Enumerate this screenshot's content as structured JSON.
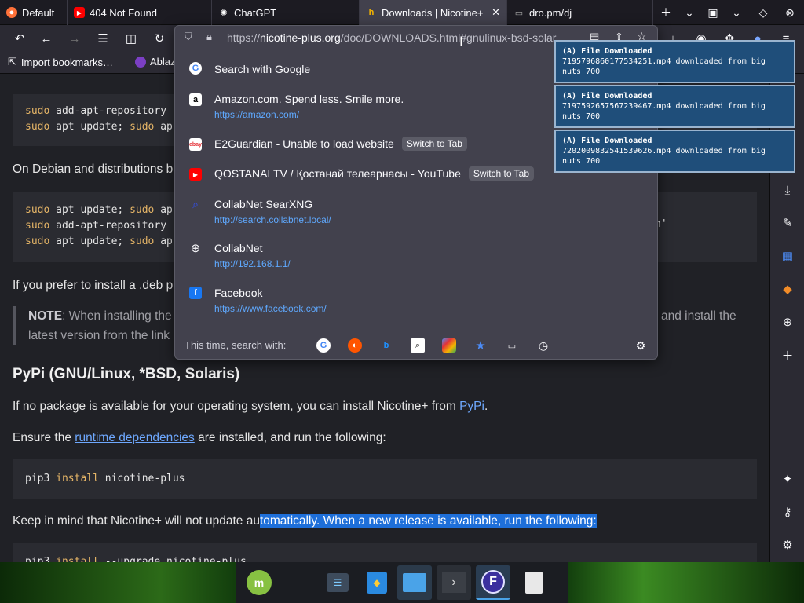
{
  "tabs": [
    {
      "title": "Default",
      "icon": "firefox-icon"
    },
    {
      "title": "404 Not Found",
      "icon": "youtube-icon"
    },
    {
      "title": "ChatGPT",
      "icon": "openai-icon"
    },
    {
      "title": "Downloads | Nicotine+",
      "icon": "nicotine-icon",
      "active": true
    },
    {
      "title": "dro.pm/dj",
      "icon": "page-icon"
    }
  ],
  "urlbar": {
    "prefix": "https://",
    "host": "nicotine-plus.org",
    "path": "/doc/DOWNLOADS.html#gnulinux-bsd-solar"
  },
  "bookmarks": {
    "import_label": "Import bookmarks…",
    "item2": "Ablaz"
  },
  "suggestions": [
    {
      "title": "Search with Google",
      "url": "",
      "icon": "google-icon"
    },
    {
      "title": "Amazon.com. Spend less. Smile more.",
      "url": "https://amazon.com/",
      "icon": "amazon-icon"
    },
    {
      "title": "E2Guardian - Unable to load website",
      "url": "",
      "icon": "ebay-icon",
      "action": "Switch to Tab"
    },
    {
      "title": "QOSTANAI TV / Қостанай телеарнасы - YouTube",
      "url": "",
      "icon": "youtube-icon",
      "action": "Switch to Tab"
    },
    {
      "title": "CollabNet SearXNG",
      "url": "http://search.collabnet.local/",
      "icon": "search-icon"
    },
    {
      "title": "CollabNet",
      "url": "http://192.168.1.1/",
      "icon": "globe-icon"
    },
    {
      "title": "Facebook",
      "url": "https://www.facebook.com/",
      "icon": "facebook-icon"
    }
  ],
  "search_with_label": "This time, search with:",
  "notifications": [
    {
      "title": "(A) File Downloaded",
      "body": "7195796860177534251.mp4 downloaded from big nuts 700"
    },
    {
      "title": "(A) File Downloaded",
      "body": "7197592657567239467.mp4 downloaded from big nuts 700"
    },
    {
      "title": "(A) File Downloaded",
      "body": "7202009832541539626.mp4 downloaded from big nuts 700"
    }
  ],
  "page": {
    "code1": [
      {
        "a": "sudo",
        "b": " add-apt-repository"
      },
      {
        "a": "sudo",
        "b": " apt update; ",
        "c": "sudo",
        "d": " ap"
      }
    ],
    "debian_text": "On Debian and distributions b",
    "code2": [
      {
        "a": "sudo",
        "b": " apt update; ",
        "c": "sudo",
        "d": " ap"
      },
      {
        "a": "sudo",
        "b": " add-apt-repository"
      },
      {
        "a": "sudo",
        "b": " apt update; ",
        "c": "sudo",
        "d": " ap"
      }
    ],
    "code2_tail": "n'",
    "deb_text": "If you prefer to install a .deb p",
    "note_label": "NOTE",
    "note_text": ": When installing the",
    "note_text_right": "and install the",
    "note_text2": "latest version from the link",
    "pypi_heading": "PyPi (GNU/Linux, *BSD, Solaris)",
    "pypi_text_before": "If no package is available for your operating system, you can install Nicotine+ from ",
    "pypi_link": "PyPi",
    "pypi_text_after": ".",
    "ensure_before": "Ensure the ",
    "ensure_link": "runtime dependencies",
    "ensure_after": " are installed, and run the following:",
    "pip_cmd": "pip3",
    "pip_kw": " install",
    "pip_arg": " nicotine-plus",
    "keep_before": "Keep in mind that Nicotine+ will not update au",
    "keep_highlight": "tomatically. When a new release is available, run the following:",
    "pip2_cmd": "pip3",
    "pip2_kw": " install",
    "pip2_arg": " --upgrade nicotine-plus"
  },
  "colors": {
    "accent": "#1e6fd9",
    "link": "#5fa9ff",
    "notif_bg": "#1f4e7a"
  }
}
